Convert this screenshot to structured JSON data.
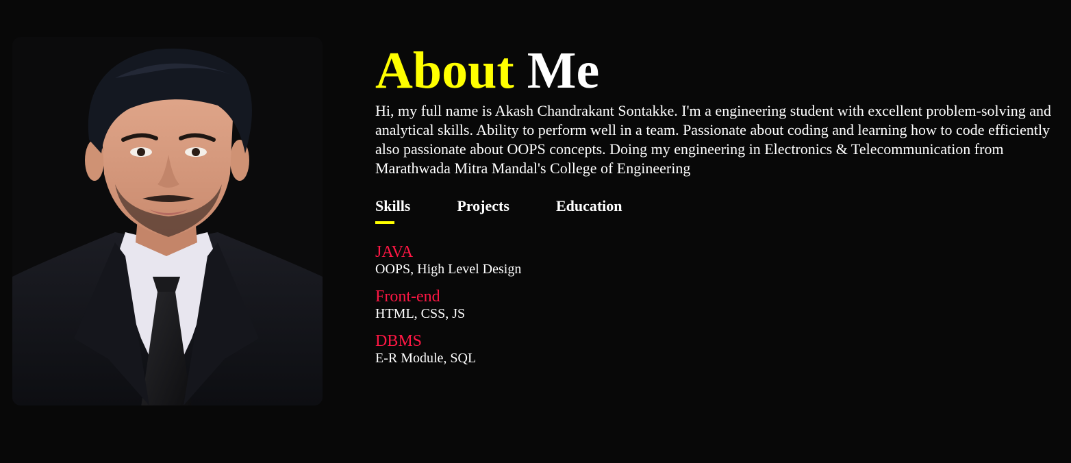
{
  "about": {
    "title_accent": "About",
    "title_rest": "Me",
    "bio": "Hi, my full name is Akash Chandrakant Sontakke. I'm a engineering student with excellent problem-solving and analytical skills. Ability to perform well in a team. Passionate about coding and learning how to code efficiently also passionate about OOPS concepts. Doing my engineering in Electronics & Telecommunication from Marathwada Mitra Mandal's College of Engineering"
  },
  "tabs": [
    {
      "label": "Skills",
      "active": true
    },
    {
      "label": "Projects",
      "active": false
    },
    {
      "label": "Education",
      "active": false
    }
  ],
  "skills": [
    {
      "name": "JAVA",
      "desc": "OOPS, High Level Design"
    },
    {
      "name": "Front-end",
      "desc": "HTML, CSS, JS"
    },
    {
      "name": "DBMS",
      "desc": "E-R Module, SQL"
    }
  ],
  "colors": {
    "background": "#080808",
    "accent_yellow": "#ffff00",
    "skill_red": "#ff1744",
    "text": "#ffffff"
  }
}
